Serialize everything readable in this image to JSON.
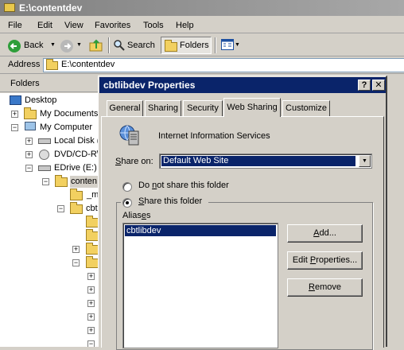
{
  "explorer": {
    "title": "E:\\contentdev",
    "menu": [
      "File",
      "Edit",
      "View",
      "Favorites",
      "Tools",
      "Help"
    ],
    "toolbar": {
      "back": "Back",
      "search": "Search",
      "folders": "Folders"
    },
    "address_label": "Address",
    "address_value": "E:\\contentdev",
    "folders_pane_title": "Folders",
    "tree": {
      "desktop": "Desktop",
      "my_documents": "My Documents",
      "my_computer": "My Computer",
      "local_disk": "Local Disk (",
      "dvd": "DVD/CD-R\\",
      "edrive": "EDrive (E:)",
      "contentdev": "conten",
      "underscore_folder": "_m",
      "cbt_folder": "cbt"
    }
  },
  "dialog": {
    "title": "cbtlibdev Properties",
    "help_btn": "?",
    "close_btn": "✕",
    "tabs": [
      "General",
      "Sharing",
      "Security",
      "Web Sharing",
      "Customize"
    ],
    "active_tab": "Web Sharing",
    "service_name": "Internet Information Services",
    "share_on_label": "Share on:",
    "share_on_value": "Default Web Site",
    "radio_not_share": "Do not share this folder",
    "radio_share": "Share this folder",
    "selected_option": "Share this folder",
    "aliases_label": "Aliases",
    "aliases": [
      "cbtlibdev"
    ],
    "buttons": {
      "add": "Add...",
      "edit": "Edit Properties...",
      "remove": "Remove"
    }
  },
  "colors": {
    "title_active": "#0a246a",
    "title_inactive": "#808080",
    "face": "#d4d0c8",
    "selection": "#0a246a"
  }
}
